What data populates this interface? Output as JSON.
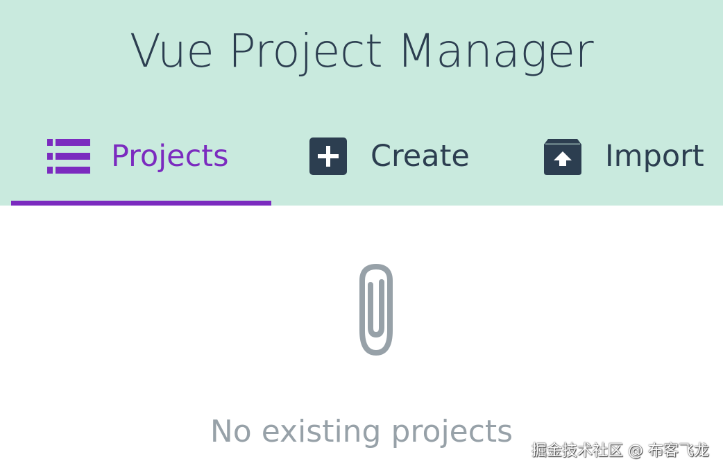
{
  "header": {
    "title": "Vue Project Manager",
    "background": "#c9eade"
  },
  "tabs": [
    {
      "label": "Projects",
      "icon": "list-icon",
      "active": true
    },
    {
      "label": "Create",
      "icon": "plus-box-icon",
      "active": false
    },
    {
      "label": "Import",
      "icon": "unarchive-icon",
      "active": false
    }
  ],
  "accent": "#7b2bbf",
  "text_color": "#2c3e50",
  "empty_state": {
    "icon": "paperclip-icon",
    "message": "No existing projects",
    "color": "#97a1a8"
  },
  "watermark": "掘金技术社区 @ 布客飞龙"
}
